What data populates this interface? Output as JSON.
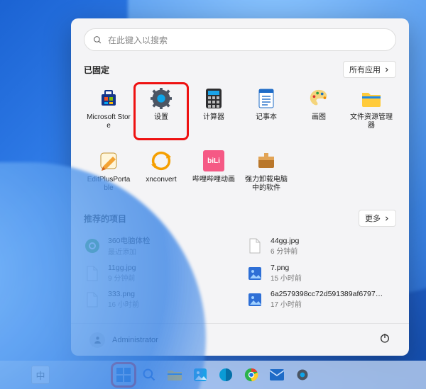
{
  "colors": {
    "accent": "#0a63c9",
    "highlight": "#e11"
  },
  "search": {
    "placeholder": "在此键入以搜索"
  },
  "pinned": {
    "header": "已固定",
    "all_apps": "所有应用",
    "items": [
      {
        "label": "Microsoft Store",
        "icon": "store-icon"
      },
      {
        "label": "设置",
        "icon": "settings-icon",
        "highlighted": true
      },
      {
        "label": "计算器",
        "icon": "calculator-icon"
      },
      {
        "label": "记事本",
        "icon": "notepad-icon"
      },
      {
        "label": "画图",
        "icon": "paint-icon"
      },
      {
        "label": "文件资源管理器",
        "icon": "explorer-icon"
      },
      {
        "label": "EditPlusPortable",
        "icon": "editplus-icon"
      },
      {
        "label": "xnconvert",
        "icon": "xnconvert-icon"
      },
      {
        "label": "哔哩哔哩动画",
        "icon": "bilibili-icon"
      },
      {
        "label": "强力卸载电脑中的软件",
        "icon": "uninstall-icon"
      }
    ]
  },
  "recommended": {
    "header": "推荐的项目",
    "more": "更多",
    "items": [
      {
        "title": "360电脑体检",
        "sub": "最近添加",
        "icon": "360-icon"
      },
      {
        "title": "44gg.jpg",
        "sub": "6 分钟前",
        "icon": "file-icon"
      },
      {
        "title": "11gg.jpg",
        "sub": "9 分钟前",
        "icon": "file-icon"
      },
      {
        "title": "7.png",
        "sub": "15 小时前",
        "icon": "img-icon"
      },
      {
        "title": "333.png",
        "sub": "16 小时前",
        "icon": "file-icon"
      },
      {
        "title": "6a2579398cc72d591389af679703f3…",
        "sub": "17 小时前",
        "icon": "img-icon"
      }
    ]
  },
  "footer": {
    "user": "Administrator"
  },
  "taskbar": {
    "lang": "中",
    "items": [
      {
        "name": "start-icon",
        "highlighted": true
      },
      {
        "name": "search-task-icon"
      },
      {
        "name": "explorer-task-icon"
      },
      {
        "name": "photos-task-icon"
      },
      {
        "name": "browser-task-icon"
      },
      {
        "name": "chrome-task-icon"
      },
      {
        "name": "mail-task-icon"
      },
      {
        "name": "settings-task-icon"
      }
    ]
  }
}
